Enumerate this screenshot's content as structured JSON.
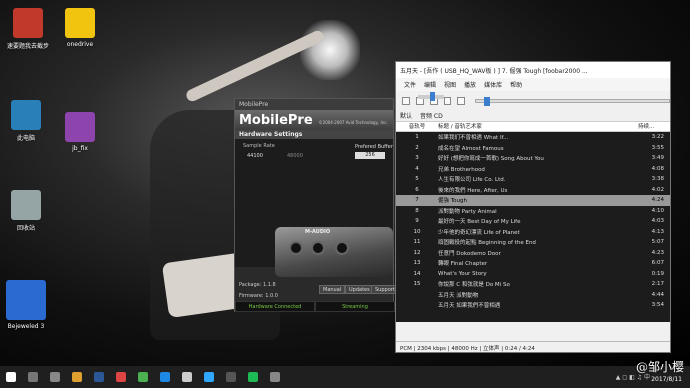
{
  "desktop": {
    "icons": [
      {
        "label": "速要题我去截步",
        "color": "#c0392b"
      },
      {
        "label": "onedrive",
        "color": "#f1c40f"
      },
      {
        "label": "此电脑",
        "color": "#2980b9"
      },
      {
        "label": "jb_fix",
        "color": "#8e44ad"
      },
      {
        "label": "回收站",
        "color": "#95a5a6"
      },
      {
        "label": "Bejeweled 3",
        "color": "#2a6bd1"
      }
    ]
  },
  "mobilepre": {
    "title": "MobilePre",
    "brand": "MobilePre",
    "copyright": "©2004-2007 Avid Technology, Inc.",
    "section": "Hardware Settings",
    "sample_rate_label": "Sample Rate",
    "sample_rate_selected": "44100",
    "sample_rate_other": "48000",
    "buffer_label": "Prefered Buffer",
    "buffer_value": "256",
    "device_brand": "M-AUDIO",
    "package": "Package: 1.1.8",
    "firmware": "Firmware: 1.0.0",
    "buttons": [
      "Manual",
      "Updates",
      "Support"
    ],
    "status_connected": "Hardware Connected",
    "status_streaming": "Streaming"
  },
  "foobar": {
    "title": "五月天 - [吾作 ( USB_HQ_WAV板 ) ] 7. 倔强 Tough   [foobar2000 ...",
    "menu": [
      "文件",
      "编辑",
      "视图",
      "播放",
      "媒体库",
      "帮助"
    ],
    "tabs": [
      "默认",
      "音频 CD"
    ],
    "columns": {
      "num": "音轨号",
      "title": "标题 / 音轨艺术家",
      "dur": "持续..."
    },
    "tracks": [
      {
        "num": "1",
        "title": "如果我们不曾相遇 What If...",
        "dur": "3:22"
      },
      {
        "num": "2",
        "title": "成名在望 Almost Famous",
        "dur": "3:55"
      },
      {
        "num": "3",
        "title": "好好 (想把你寫成一首歌) Song About You",
        "dur": "3:49"
      },
      {
        "num": "4",
        "title": "兄弟 Brotherhood",
        "dur": "4:08"
      },
      {
        "num": "5",
        "title": "人生有限公司 Life Co. Ltd.",
        "dur": "3:38"
      },
      {
        "num": "6",
        "title": "後來的我們 Here, After, Us",
        "dur": "4:02"
      },
      {
        "num": "7",
        "title": "倔強 Tough",
        "dur": "4:24",
        "playing": true
      },
      {
        "num": "8",
        "title": "派對動物 Party Animal",
        "dur": "4:10"
      },
      {
        "num": "9",
        "title": "最好的一天 Best Day of My Life",
        "dur": "4:03"
      },
      {
        "num": "10",
        "title": "少年他的奇幻漂流 Life of Planet",
        "dur": "4:13"
      },
      {
        "num": "11",
        "title": "頑固戰役的起點 Beginning of the End",
        "dur": "5:07"
      },
      {
        "num": "12",
        "title": "任意門 Dokodemo Door",
        "dur": "4:23"
      },
      {
        "num": "13",
        "title": "轉眼 Final Chapter",
        "dur": "6:07"
      },
      {
        "num": "14",
        "title": "What's Your Story",
        "dur": "0:19"
      },
      {
        "num": "15",
        "title": "你說那 C 和弦就是 Do Mi So",
        "dur": "2:17"
      },
      {
        "num": "",
        "title": "五月天 派對動物",
        "dur": "4:44"
      },
      {
        "num": "",
        "title": "五月天 如果我們不曾相遇",
        "dur": "3:54"
      }
    ],
    "status": "PCM | 2304 kbps | 48000 Hz | 立体声 | 0:24 / 4:24"
  },
  "watermark": {
    "name": "@邹小樱",
    "date": "2017/8/11"
  }
}
